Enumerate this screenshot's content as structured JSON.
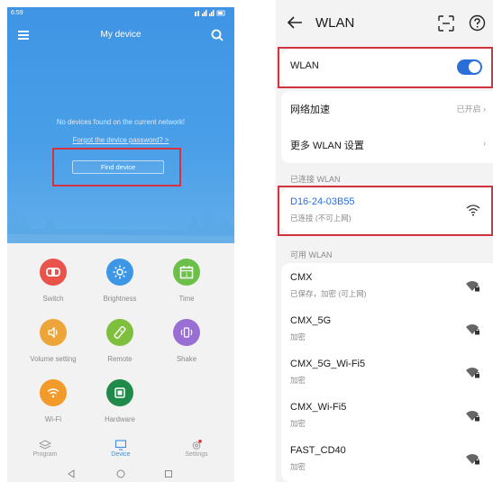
{
  "left_app": {
    "status_time": "6:59",
    "status_right": "☷ ´▐▐ill ▐ill ▭",
    "title": "My device",
    "no_devices_text": "No devices found on the current network!",
    "forgot_password_link": "Forgot the device password? >",
    "find_device_button": "Find device",
    "tiles": [
      {
        "label": "Switch",
        "icon": "switch-icon",
        "color": "#e8544a"
      },
      {
        "label": "Brightness",
        "icon": "brightness-icon",
        "color": "#3d97e6"
      },
      {
        "label": "Time",
        "icon": "calendar-icon",
        "color": "#6cc04a"
      },
      {
        "label": "Volume setting",
        "icon": "volume-icon",
        "color": "#eda53a"
      },
      {
        "label": "Remote",
        "icon": "remote-icon",
        "color": "#7fbf3e"
      },
      {
        "label": "Shake",
        "icon": "shake-icon",
        "color": "#9a6fd3"
      },
      {
        "label": "Wi-Fi",
        "icon": "wifi-icon",
        "color": "#f29b2b"
      },
      {
        "label": "Hardware",
        "icon": "chip-icon",
        "color": "#1f8a4a"
      }
    ],
    "tabs": [
      {
        "label": "Program",
        "icon": "layers-icon"
      },
      {
        "label": "Device",
        "icon": "monitor-icon",
        "active": true
      },
      {
        "label": "Settings",
        "icon": "gear-icon"
      }
    ]
  },
  "right_app": {
    "title": "WLAN",
    "wlan_toggle_label": "WLAN",
    "wlan_enabled": true,
    "network_accel_label": "网络加速",
    "network_accel_value": "已开启",
    "more_settings_label": "更多 WLAN 设置",
    "connected_header": "已连接 WLAN",
    "connected": {
      "name": "D16-24-03B55",
      "status": "已连接 (不可上网)"
    },
    "available_header": "可用 WLAN",
    "available": [
      {
        "name": "CMX",
        "status": "已保存，加密 (可上网)"
      },
      {
        "name": "CMX_5G",
        "status": "加密"
      },
      {
        "name": "CMX_5G_Wi-Fi5",
        "status": "加密"
      },
      {
        "name": "CMX_Wi-Fi5",
        "status": "加密"
      },
      {
        "name": "FAST_CD40",
        "status": "加密"
      }
    ],
    "colors": {
      "accent": "#2a6fd8",
      "highlight": "#d3333f"
    }
  }
}
